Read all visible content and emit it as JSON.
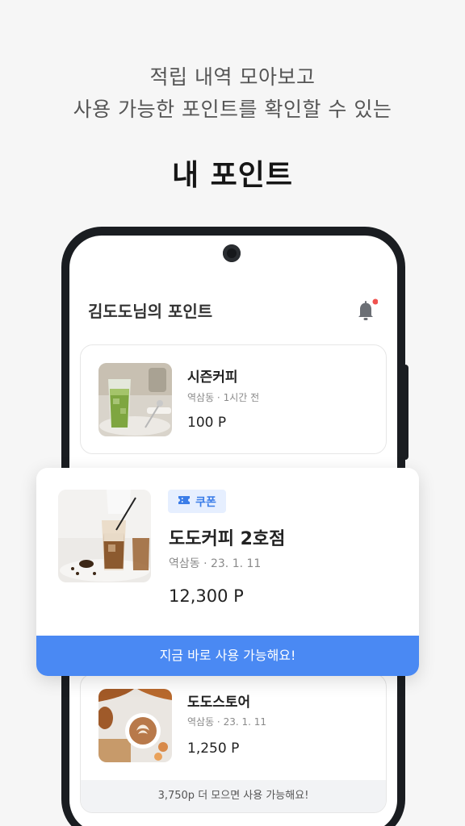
{
  "headline": {
    "line1": "적립 내역 모아보고",
    "line2": "사용 가능한 포인트를 확인할 수 있는",
    "title": "내 포인트"
  },
  "screen": {
    "title": "김도도님의 포인트",
    "notification_icon": "bell-icon",
    "notification_dot_color": "#f0524f"
  },
  "cards": [
    {
      "store": "시즌커피",
      "meta": "역삼동 · 1시간 전",
      "points": "100 P",
      "image": "matcha-latte-photo"
    },
    {
      "badge": "쿠폰",
      "badge_icon": "ticket-icon",
      "store": "도도커피 2호점",
      "meta": "역삼동 · 23. 1. 11",
      "points": "12,300 P",
      "cta": "지금 바로 사용 가능해요!",
      "image": "iced-coffee-photo"
    },
    {
      "store": "도도스토어",
      "meta": "역삼동 · 23. 1. 11",
      "points": "1,250 P",
      "footer": "3,750p 더 모으면 사용 가능해요!",
      "image": "latte-croissant-photo"
    }
  ],
  "colors": {
    "accent": "#4a89f3",
    "badge_bg": "#e6efff",
    "badge_text": "#3b7de8"
  }
}
